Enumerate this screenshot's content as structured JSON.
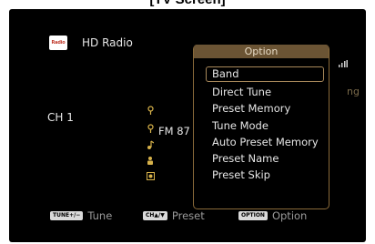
{
  "caption": "[TV Screen]",
  "colors": {
    "screen_bg": "#000000",
    "accent": "#8a6a3a",
    "title_bar": "#6b5434"
  },
  "header": {
    "logo_text": "Radio",
    "source_name": "HD Radio"
  },
  "status": {
    "channel": "CH 1",
    "frequency": "FM 87",
    "icons": [
      "antenna-icon",
      "antenna-icon",
      "music-note-icon",
      "person-icon",
      "album-art-icon"
    ]
  },
  "right_fragment": "ng",
  "popup": {
    "title": "Option",
    "items": [
      "Band",
      "Direct Tune",
      "Preset Memory",
      "Tune Mode",
      "Auto Preset Memory",
      "Preset Name",
      "Preset Skip"
    ],
    "selected_index": 0
  },
  "legend": [
    {
      "key": "TUNE+/−",
      "label": "Tune"
    },
    {
      "key": "CH▲/▼",
      "label": "Preset"
    },
    {
      "key": "OPTION",
      "label": "Option"
    }
  ]
}
